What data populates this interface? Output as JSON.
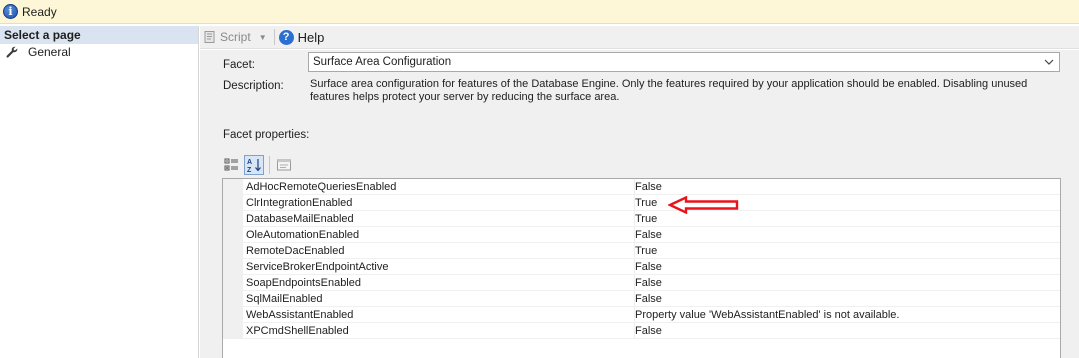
{
  "status": {
    "icon": "info-icon",
    "text": "Ready"
  },
  "left_pane": {
    "header": "Select a page",
    "pages": [
      {
        "label": "General",
        "icon": "wrench-icon"
      }
    ]
  },
  "toolbar": {
    "script_label": "Script",
    "help_label": "Help"
  },
  "form": {
    "facet_label": "Facet:",
    "facet_value": "Surface Area Configuration",
    "description_label": "Description:",
    "description_text": "Surface area configuration for features of the Database Engine. Only the features required by your application should be enabled. Disabling unused features helps protect your server by reducing the surface area.",
    "facet_properties_label": "Facet properties:"
  },
  "properties": [
    {
      "name": "AdHocRemoteQueriesEnabled",
      "value": "False"
    },
    {
      "name": "ClrIntegrationEnabled",
      "value": "True"
    },
    {
      "name": "DatabaseMailEnabled",
      "value": "True"
    },
    {
      "name": "OleAutomationEnabled",
      "value": "False"
    },
    {
      "name": "RemoteDacEnabled",
      "value": "True"
    },
    {
      "name": "ServiceBrokerEndpointActive",
      "value": "False"
    },
    {
      "name": "SoapEndpointsEnabled",
      "value": "False"
    },
    {
      "name": "SqlMailEnabled",
      "value": "False"
    },
    {
      "name": "WebAssistantEnabled",
      "value": "Property value 'WebAssistantEnabled' is not available."
    },
    {
      "name": "XPCmdShellEnabled",
      "value": "False"
    }
  ],
  "colors": {
    "status_bar": "#fdf7d8",
    "left_header": "#dae3f0",
    "panel": "#f0f0f0",
    "annotation_arrow": "#e8141c"
  }
}
